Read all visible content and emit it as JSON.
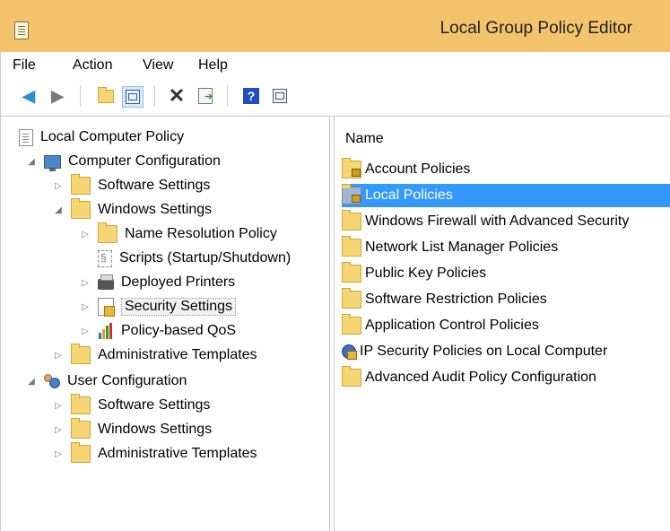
{
  "window": {
    "title": "Local Group Policy Editor"
  },
  "menu": [
    "File",
    "Action",
    "View",
    "Help"
  ],
  "toolbar": {
    "icons": [
      "back-icon",
      "forward-icon",
      "up-folder-icon",
      "show-hide-tree-icon",
      "delete-icon",
      "export-list-icon",
      "help-icon",
      "show-hide-action-pane-icon"
    ]
  },
  "tree": {
    "root": "Local Computer Policy",
    "computer": {
      "label": "Computer Configuration",
      "software": "Software Settings",
      "windows": "Windows Settings",
      "name_resolution": "Name Resolution Policy",
      "scripts": "Scripts (Startup/Shutdown)",
      "printers": "Deployed Printers",
      "security": "Security Settings",
      "qos": "Policy-based QoS",
      "admin": "Administrative Templates"
    },
    "user": {
      "label": "User Configuration",
      "software": "Software Settings",
      "windows": "Windows Settings",
      "admin": "Administrative Templates"
    }
  },
  "list": {
    "header": "Name",
    "items": [
      "Account Policies",
      "Local Policies",
      "Windows Firewall with Advanced Security",
      "Network List Manager Policies",
      "Public Key Policies",
      "Software Restriction Policies",
      "Application Control Policies",
      "IP Security Policies on Local Computer",
      "Advanced Audit Policy Configuration"
    ],
    "selected": "Local Policies"
  },
  "colors": {
    "titlebar": "#f2c36a",
    "selection": "#3399ff"
  }
}
